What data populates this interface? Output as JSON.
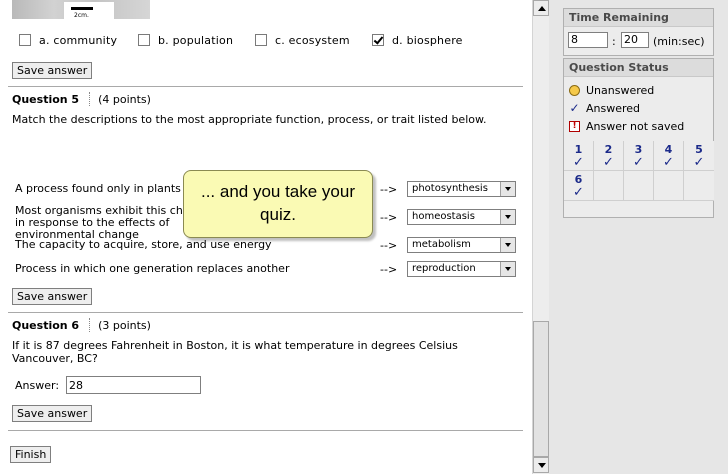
{
  "question4": {
    "scale_label": "2cm.",
    "options": [
      {
        "label": "a. community",
        "checked": false
      },
      {
        "label": "b. population",
        "checked": false
      },
      {
        "label": "c. ecosystem",
        "checked": false
      },
      {
        "label": "d. biosphere",
        "checked": true
      }
    ],
    "save_label": "Save answer"
  },
  "question5": {
    "title": "Question 5",
    "points": "(4 points)",
    "text": "Match the descriptions to the most appropriate function, process, or trait listed below.",
    "rows": [
      {
        "description": "A process found only in plants",
        "arrow": "-->",
        "selected": "photosynthesis"
      },
      {
        "description": "Most organisms exhibit this characteristic in response to the effects of environmental change",
        "arrow": "-->",
        "selected": "homeostasis"
      },
      {
        "description": "The capacity to acquire, store, and use energy",
        "arrow": "-->",
        "selected": "metabolism"
      },
      {
        "description": "Process in which one generation replaces another",
        "arrow": "-->",
        "selected": "reproduction"
      }
    ],
    "save_label": "Save answer"
  },
  "question6": {
    "title": "Question 6",
    "points": "(3 points)",
    "text": "If it is 87 degrees Fahrenheit in Boston, it is what temperature in degrees Celsius Vancouver, BC?",
    "answer_label": "Answer:",
    "answer_value": "28",
    "save_label": "Save answer"
  },
  "finish_label": "Finish",
  "callout": {
    "text": "... and you take your quiz."
  },
  "time_remaining": {
    "title": "Time Remaining",
    "minutes": "8",
    "separator": ":",
    "seconds": "20",
    "units": "(min:sec)"
  },
  "question_status": {
    "title": "Question Status",
    "legend": {
      "unanswered": "Unanswered",
      "answered": "Answered",
      "not_saved": "Answer not saved"
    },
    "questions": [
      {
        "number": "1",
        "status": "answered",
        "mark": "✓"
      },
      {
        "number": "2",
        "status": "answered",
        "mark": "✓"
      },
      {
        "number": "3",
        "status": "answered",
        "mark": "✓"
      },
      {
        "number": "4",
        "status": "answered",
        "mark": "✓"
      },
      {
        "number": "5",
        "status": "answered",
        "mark": "✓"
      },
      {
        "number": "6",
        "status": "answered",
        "mark": "✓"
      }
    ]
  },
  "icons": {
    "answered": "check-icon",
    "unanswered": "yellow-circle-icon",
    "not_saved": "exclamation-box-icon"
  },
  "colors": {
    "status_blue": "#1b2a8a",
    "callout_bg": "#fafab4",
    "unanswered_yellow": "#f5c94a",
    "warning_red": "#c00000"
  }
}
